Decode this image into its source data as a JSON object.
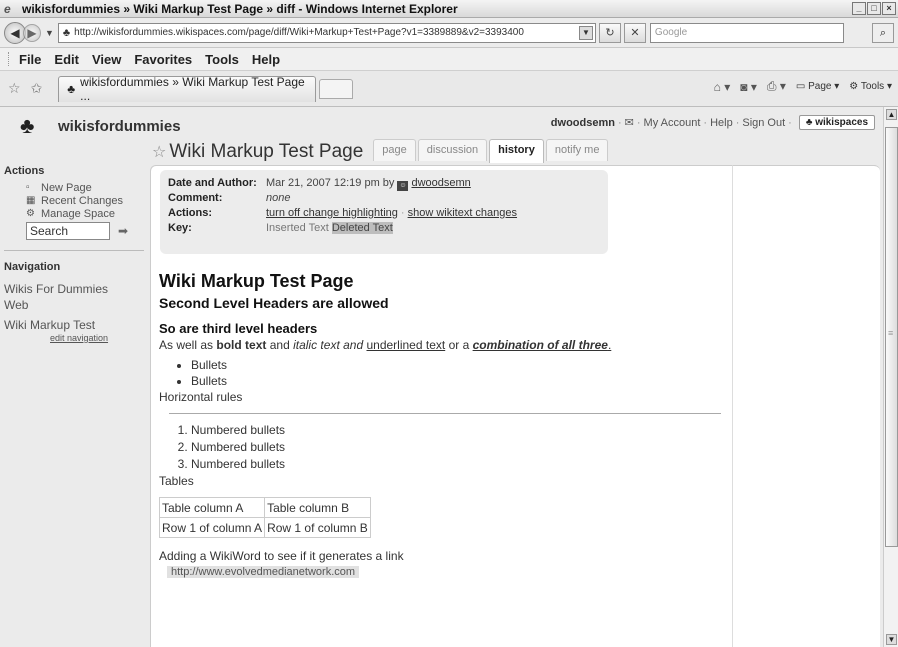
{
  "window": {
    "title": "wikisfordummies » Wiki Markup Test Page » diff - Windows Internet Explorer"
  },
  "address_bar": {
    "url": "http://wikisfordummies.wikispaces.com/page/diff/Wiki+Markup+Test+Page?v1=3389889&v2=3393400",
    "search_placeholder": "Google"
  },
  "menu": [
    "File",
    "Edit",
    "View",
    "Favorites",
    "Tools",
    "Help"
  ],
  "browser_tab": {
    "label": "wikisfordummies » Wiki Markup Test Page ..."
  },
  "command_bar": {
    "page_label": "Page",
    "tools_label": "Tools"
  },
  "site": {
    "name": "wikisfordummies",
    "user": "dwoodsemn",
    "my_account": "My Account",
    "help": "Help",
    "sign_out": "Sign Out",
    "wikispaces_button": "wikispaces"
  },
  "page": {
    "title": "Wiki Markup Test Page",
    "tabs": [
      {
        "label": "page",
        "active": false
      },
      {
        "label": "discussion",
        "active": false
      },
      {
        "label": "history",
        "active": true
      },
      {
        "label": "notify me",
        "active": false
      }
    ]
  },
  "sidebar": {
    "actions_heading": "Actions",
    "actions": [
      {
        "label": "New Page",
        "icon": "new-page-icon"
      },
      {
        "label": "Recent Changes",
        "icon": "calendar-icon"
      },
      {
        "label": "Manage Space",
        "icon": "gear-icon"
      }
    ],
    "search_value": "Search",
    "navigation_heading": "Navigation",
    "nav_items": [
      "Wikis For Dummies",
      "Web",
      "Wiki Markup Test"
    ],
    "edit_navigation": "edit navigation"
  },
  "diff_info": {
    "date_label": "Date and Author:",
    "date_value": "Mar 21, 2007 12:19 pm by",
    "author": "dwoodsemn",
    "comment_label": "Comment:",
    "comment_value": "none",
    "actions_label": "Actions:",
    "action_1": "turn off change highlighting",
    "action_2": "show wikitext changes",
    "key_label": "Key:",
    "key_inserted": "Inserted Text",
    "key_deleted": "Deleted Text"
  },
  "wiki": {
    "h1": "Wiki Markup Test Page",
    "h2": "Second Level Headers are allowed",
    "h3": "So are third level headers",
    "para_1": "As well as",
    "bold": "bold text",
    "para_2": "and",
    "italic": "italic text and",
    "underlined": "underlined text",
    "para_3": "or a",
    "combo": "combination of all three",
    "para_end": ".",
    "bullets": [
      "Bullets",
      "Bullets"
    ],
    "hr_label": "Horizontal rules",
    "numbered": [
      "Numbered bullets",
      "Numbered bullets",
      "Numbered bullets"
    ],
    "tables_label": "Tables",
    "table": [
      [
        "Table column A",
        "Table column B"
      ],
      [
        "Row 1 of column A",
        "Row 1 of column B"
      ]
    ],
    "wikiword_text": "Adding a WikiWord to see if it generates a link",
    "link": "http://www.evolvedmedianetwork.com"
  }
}
